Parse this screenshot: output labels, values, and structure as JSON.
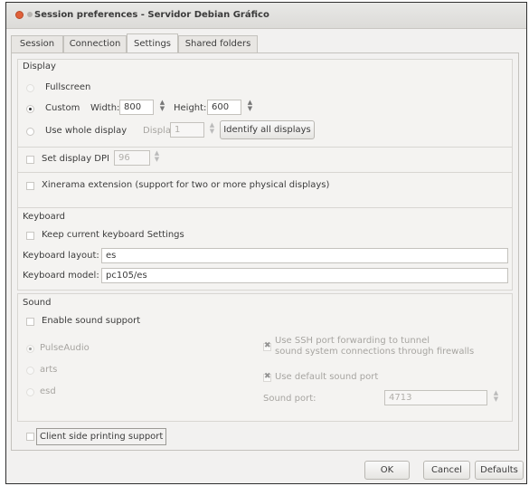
{
  "window": {
    "title": "Session preferences - Servidor Debian Gráfico"
  },
  "tabs": [
    {
      "label": "Session"
    },
    {
      "label": "Connection"
    },
    {
      "label": "Settings"
    },
    {
      "label": "Shared folders"
    }
  ],
  "display": {
    "title": "Display",
    "fullscreen_label": "Fullscreen",
    "custom_label": "Custom",
    "width_label": "Width:",
    "width_value": "800",
    "height_label": "Height:",
    "height_value": "600",
    "use_whole_display_label": "Use whole display",
    "display_label": "Display:",
    "display_value": "1",
    "identify_button": "Identify all displays",
    "dpi_label": "Set display DPI",
    "dpi_value": "96",
    "xinerama_label": "Xinerama extension (support for two or more physical displays)"
  },
  "keyboard": {
    "title": "Keyboard",
    "keep_settings_label": "Keep current keyboard Settings",
    "layout_label": "Keyboard layout:",
    "layout_value": "es",
    "model_label": "Keyboard model:",
    "model_value": "pc105/es"
  },
  "sound": {
    "title": "Sound",
    "enable_label": "Enable sound support",
    "pulseaudio_label": "PulseAudio",
    "arts_label": "arts",
    "esd_label": "esd",
    "ssh_forward_line1": "Use SSH port forwarding to tunnel",
    "ssh_forward_line2": "sound system connections through firewalls",
    "default_port_label": "Use default sound port",
    "sound_port_label": "Sound port:",
    "sound_port_value": "4713"
  },
  "printing": {
    "label": "Client side printing support"
  },
  "buttons": {
    "ok": "OK",
    "cancel": "Cancel",
    "defaults": "Defaults"
  },
  "colors": {
    "accent_close": "#e0613a",
    "window_bg": "#f2f1f0"
  }
}
